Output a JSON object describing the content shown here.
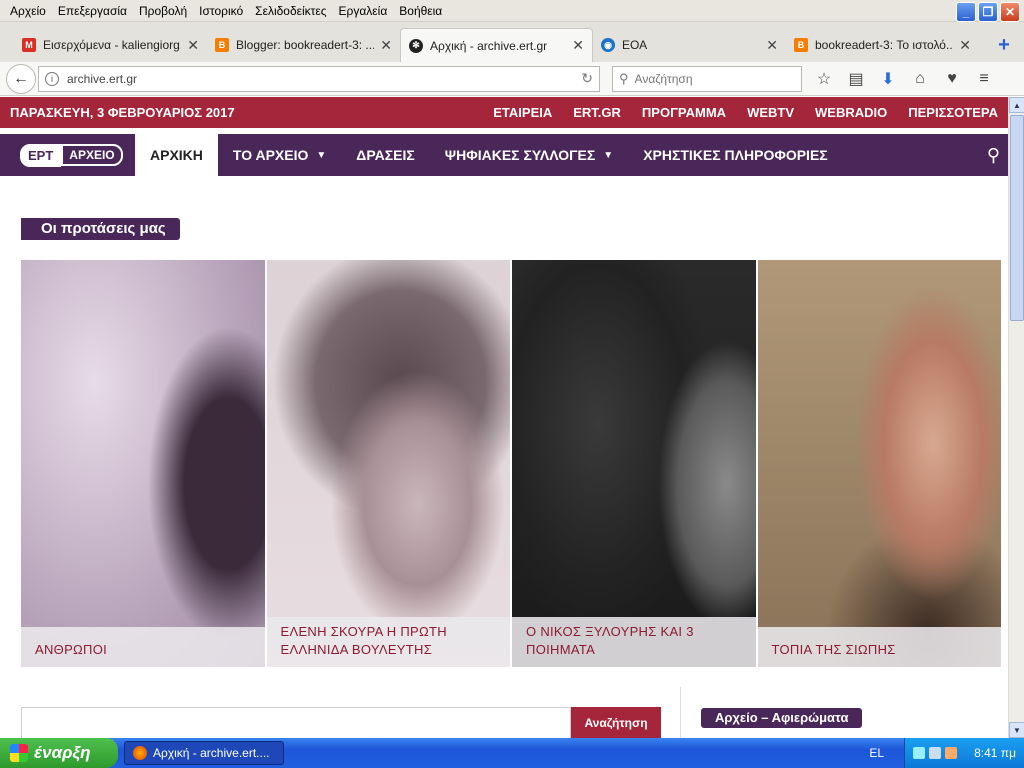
{
  "menubar": {
    "items": [
      "Αρχείο",
      "Επεξεργασία",
      "Προβολή",
      "Ιστορικό",
      "Σελιδοδείκτες",
      "Εργαλεία",
      "Βοήθεια"
    ]
  },
  "window_controls": {
    "minimize": "_",
    "restore": "❐",
    "close": "✕"
  },
  "tabs": [
    {
      "title": "Εισερχόμενα - kaliengiorg...",
      "icon": "gmail-icon",
      "color": "#d93025"
    },
    {
      "title": "Blogger: bookreadert-3: ...",
      "icon": "blogger-icon",
      "color": "#f57d00"
    },
    {
      "title": "Αρχική - archive.ert.gr",
      "icon": "film-reel-icon",
      "color": "#222222",
      "active": true
    },
    {
      "title": "ΕΟΑ",
      "icon": "eoa-icon",
      "color": "#1a73c8"
    },
    {
      "title": "bookreadert-3: Το ιστολό...",
      "icon": "blogger-icon",
      "color": "#f57d00"
    }
  ],
  "newtab_label": "+",
  "navbar": {
    "back_label": "←",
    "url": "archive.ert.gr",
    "reload_label": "↻",
    "search_placeholder": "Αναζήτηση",
    "icons": [
      "star-icon",
      "reading-list-icon",
      "download-icon",
      "home-icon",
      "pocket-icon",
      "menu-icon"
    ],
    "icon_glyphs": [
      "☆",
      "▤",
      "⬇",
      "⌂",
      "♥",
      "≡"
    ]
  },
  "page": {
    "date": "ΠΑΡΑΣΚΕΥΗ, 3 ΦΕΒΡΟΥΑΡΙΟΣ 2017",
    "top_links": [
      "ΕΤΑΙΡΕΙΑ",
      "ERT.GR",
      "ΠΡΟΓΡΑΜΜΑ",
      "WEBTV",
      "WEBRADIO",
      "ΠΕΡΙΣΣΟΤΕΡΑ"
    ],
    "logo": {
      "ert": "ΕΡΤ",
      "archive": "ΑΡΧΕΙΟ"
    },
    "nav": [
      {
        "label": "ΑΡΧΙΚΗ",
        "active": true,
        "dropdown": false
      },
      {
        "label": "ΤΟ ΑΡΧΕΙΟ",
        "active": false,
        "dropdown": true
      },
      {
        "label": "ΔΡΑΣΕΙΣ",
        "active": false,
        "dropdown": false
      },
      {
        "label": "ΨΗΦΙΑΚΕΣ ΣΥΛΛΟΓΕΣ",
        "active": false,
        "dropdown": true
      },
      {
        "label": "ΧΡΗΣΤΙΚΕΣ ΠΛΗΡΟΦΟΡΙΕΣ",
        "active": false,
        "dropdown": false
      }
    ],
    "search_icon_glyph": "⚲",
    "section_title": "Οι προτάσεις μας",
    "cards": [
      {
        "caption": "ΑΝΘΡΩΠΟΙ"
      },
      {
        "caption": "ΕΛΕΝΗ ΣΚΟΥΡΑ Η ΠΡΩΤΗ ΕΛΛΗΝΙΔΑ ΒΟΥΛΕΥΤΗΣ"
      },
      {
        "caption": "Ο ΝΙΚΟΣ ΞΥΛΟΥΡΗΣ ΚΑΙ 3 ΠΟΙΗΜΑΤΑ"
      },
      {
        "caption": "ΤΟΠΙΑ ΤΗΣ ΣΙΩΠΗΣ"
      }
    ],
    "bottom_search_button": "Αναζήτηση",
    "aside_title": "Αρχείο – Αφιερώματα"
  },
  "taskbar": {
    "start_label": "έναρξη",
    "app_title": "Αρχική - archive.ert....",
    "language": "EL",
    "clock": "8:41 πμ"
  },
  "colors": {
    "brand_red": "#a5263b",
    "brand_purple": "#4a2759"
  }
}
